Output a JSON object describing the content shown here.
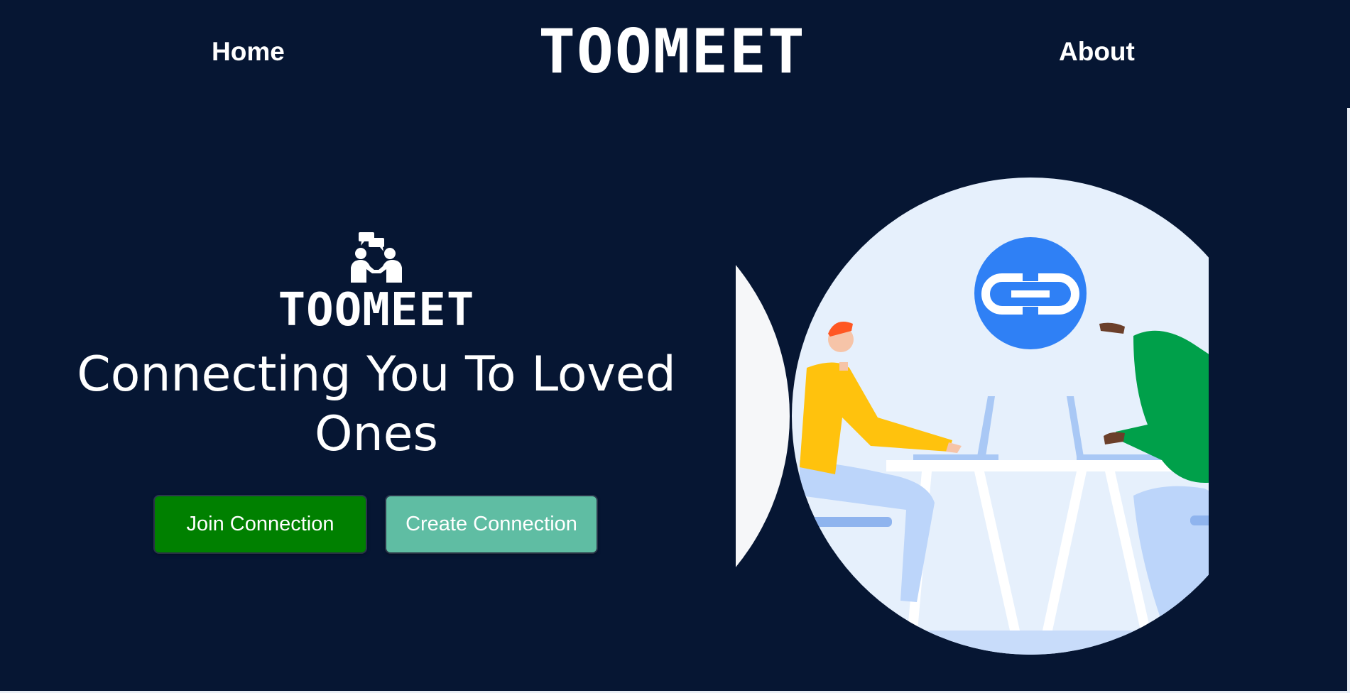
{
  "nav": {
    "home_label": "Home",
    "brand": "TOOMEET",
    "about_label": "About"
  },
  "hero": {
    "brand": "TOOMEET",
    "tagline": "Connecting You To Loved Ones",
    "join_label": "Join Connection",
    "create_label": "Create Connection"
  },
  "colors": {
    "background": "#061633",
    "join_button": "#008000",
    "create_button": "#5fbda3",
    "link_badge": "#2f80f5"
  },
  "icons": {
    "hero_logo": "people-chat-icon",
    "link": "link-icon"
  }
}
